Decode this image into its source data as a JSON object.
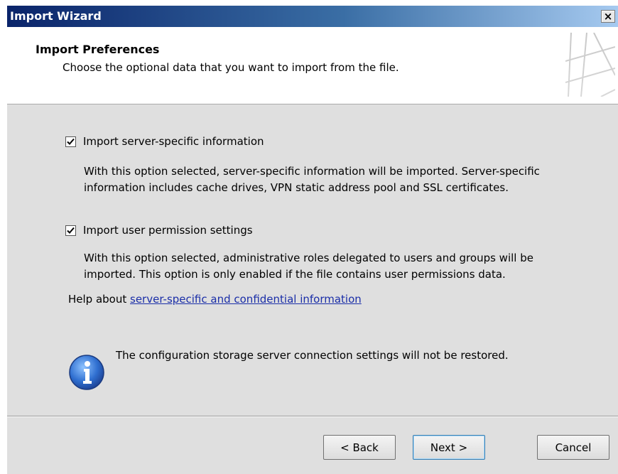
{
  "window": {
    "title": "Import Wizard",
    "close_label": "×"
  },
  "header": {
    "title": "Import Preferences",
    "subtitle": "Choose the optional data that you want to import from the file."
  },
  "options": [
    {
      "label": "Import server-specific information",
      "checked": true,
      "description_line1": "With this option selected, server-specific information will be imported. Server-specific",
      "description_line2": "information includes cache drives, VPN static address pool and SSL certificates."
    },
    {
      "label": "Import user permission settings",
      "checked": true,
      "description_line1": "With this option selected, administrative roles delegated to users and groups will be",
      "description_line2": "imported. This option is only enabled if the file contains user permissions data."
    }
  ],
  "help": {
    "prefix": "Help about ",
    "link_text": "server-specific and confidential information"
  },
  "info": {
    "icon": "info-icon",
    "text": "The configuration storage server connection settings will not be restored."
  },
  "buttons": {
    "back": "< Back",
    "next": "Next >",
    "cancel": "Cancel"
  }
}
